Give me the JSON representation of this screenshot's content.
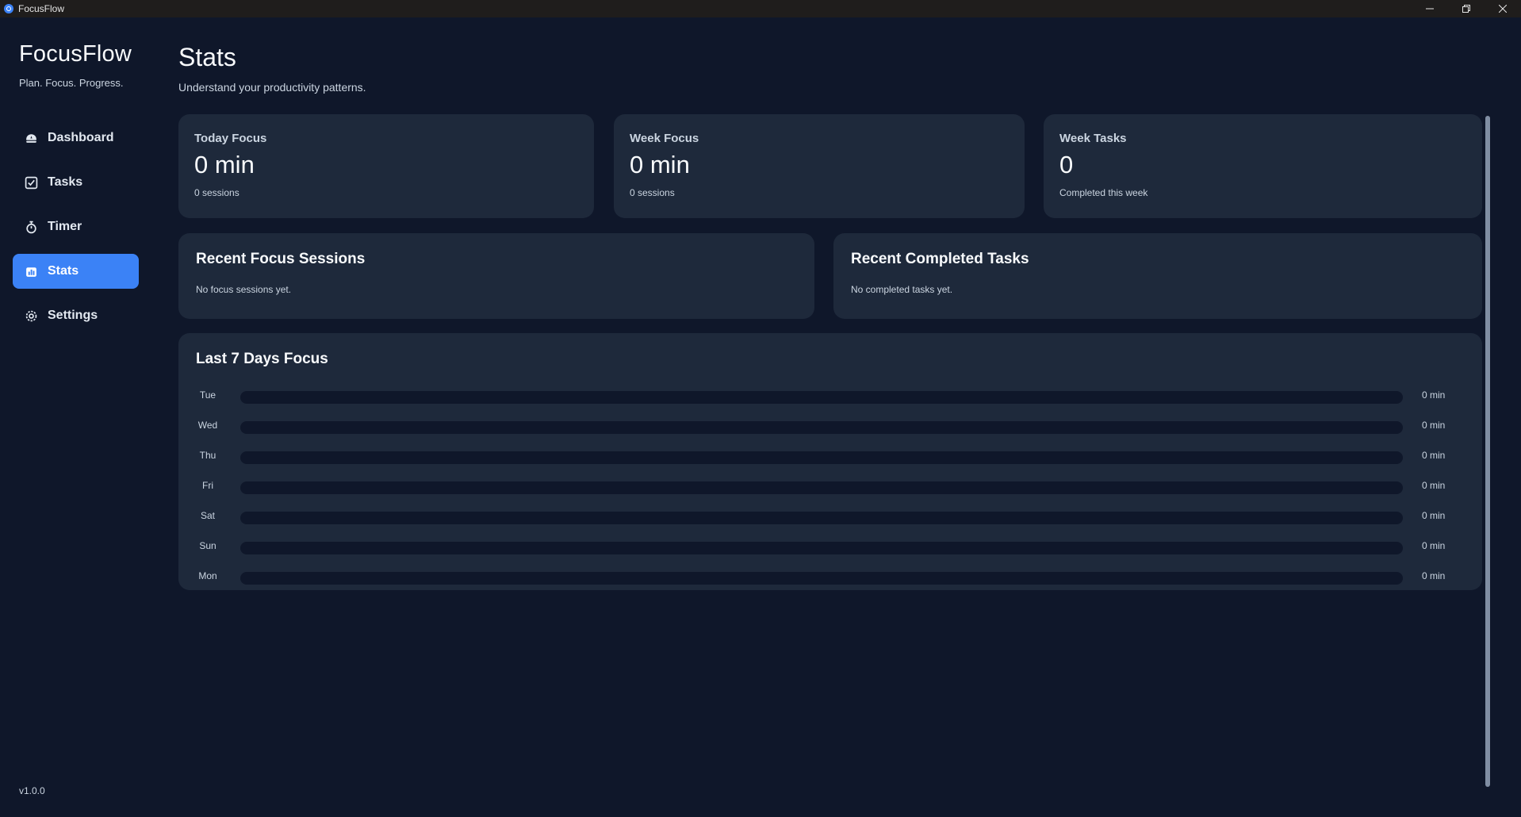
{
  "window": {
    "title": "FocusFlow",
    "controls": [
      "minimize-icon",
      "restore-icon",
      "close-icon"
    ]
  },
  "sidebar": {
    "brand": "FocusFlow",
    "tagline": "Plan. Focus. Progress.",
    "items": [
      {
        "label": "Dashboard",
        "icon": "dashboard-icon",
        "active": false
      },
      {
        "label": "Tasks",
        "icon": "checkbox-icon",
        "active": false
      },
      {
        "label": "Timer",
        "icon": "stopwatch-icon",
        "active": false
      },
      {
        "label": "Stats",
        "icon": "chart-icon",
        "active": true
      },
      {
        "label": "Settings",
        "icon": "gear-icon",
        "active": false
      }
    ],
    "version": "v1.0.0"
  },
  "header": {
    "title": "Stats",
    "subtitle": "Understand your productivity patterns."
  },
  "stats": [
    {
      "label": "Today Focus",
      "value": "0 min",
      "sub": "0 sessions"
    },
    {
      "label": "Week Focus",
      "value": "0 min",
      "sub": "0 sessions"
    },
    {
      "label": "Week Tasks",
      "value": "0",
      "sub": "Completed this week"
    }
  ],
  "recent_sessions": {
    "title": "Recent Focus Sessions",
    "empty": "No focus sessions yet."
  },
  "recent_tasks": {
    "title": "Recent Completed Tasks",
    "empty": "No completed tasks yet."
  },
  "last7": {
    "title": "Last 7 Days Focus",
    "days": [
      {
        "day": "Tue",
        "label": "0 min",
        "minutes": 0
      },
      {
        "day": "Wed",
        "label": "0 min",
        "minutes": 0
      },
      {
        "day": "Thu",
        "label": "0 min",
        "minutes": 0
      },
      {
        "day": "Fri",
        "label": "0 min",
        "minutes": 0
      },
      {
        "day": "Sat",
        "label": "0 min",
        "minutes": 0
      },
      {
        "day": "Sun",
        "label": "0 min",
        "minutes": 0
      },
      {
        "day": "Mon",
        "label": "0 min",
        "minutes": 0
      }
    ]
  },
  "colors": {
    "background": "#0f172a",
    "card": "#1e293b",
    "accent": "#3b82f6"
  }
}
